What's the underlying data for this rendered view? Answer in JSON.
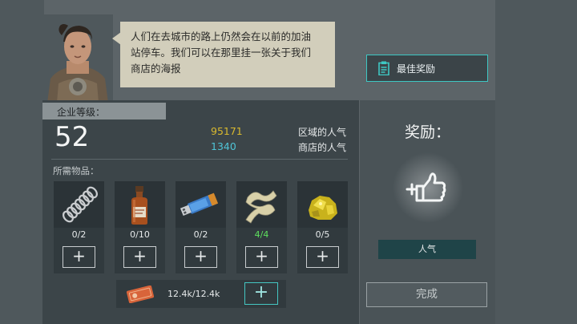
{
  "dialog": {
    "line1": "人们在去城市的路上仍然会在以前的加油",
    "line2": "站停车。我们可以在那里挂一张关于我们",
    "line3": "商店的海报"
  },
  "best_reward_label": "最佳奖励",
  "company": {
    "level_label": "企业等级：",
    "level": "52",
    "regional_popularity_value": "95171",
    "regional_popularity_label": "区域的人气",
    "shop_popularity_value": "1340",
    "shop_popularity_label": "商店的人气"
  },
  "required_label": "所需物品：",
  "items": [
    {
      "name": "spring",
      "count": "0/2",
      "complete": false
    },
    {
      "name": "bottle",
      "count": "0/10",
      "complete": false
    },
    {
      "name": "usb-drive",
      "count": "0/2",
      "complete": false
    },
    {
      "name": "cloth",
      "count": "4/4",
      "complete": true
    },
    {
      "name": "gold-nugget",
      "count": "0/5",
      "complete": false
    }
  ],
  "plus_symbol": "+",
  "money": {
    "value": "12.4k/12.4k"
  },
  "reward": {
    "title": "奖励：",
    "tag": "人气",
    "icon": "thumbs-up-plus-icon"
  },
  "complete_label": "完成",
  "colors": {
    "accent": "#3ec7c3",
    "regional": "#d9b92e",
    "shop": "#4fc4d6",
    "complete_count": "#5ee05e"
  }
}
